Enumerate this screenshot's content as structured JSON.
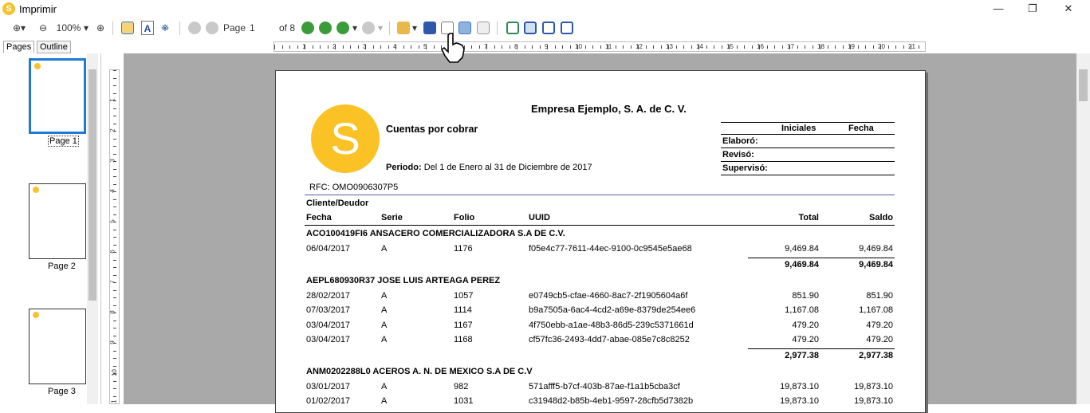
{
  "window": {
    "title": "Imprimir",
    "app_icon_letter": "S"
  },
  "controls": {
    "minimize": "—",
    "maximize": "❐",
    "close": "✕"
  },
  "toolbar": {
    "zoom_level": "100%",
    "page_label": "Page",
    "page_value": "1",
    "page_of": "of 8"
  },
  "tabs": [
    {
      "label": "Pages"
    },
    {
      "label": "Outline"
    }
  ],
  "thumbnails": [
    {
      "label": "Page 1"
    },
    {
      "label": "Page 2"
    },
    {
      "label": "Page 3"
    }
  ],
  "ruler": {
    "marks": [
      "1",
      "2",
      "3",
      "4",
      "5",
      "6",
      "7",
      "8",
      "9",
      "10",
      "11",
      "12",
      "13",
      "14",
      "15",
      "16",
      "17",
      "18",
      "19",
      "20",
      "21"
    ]
  },
  "vruler": {
    "marks": [
      "1",
      "2",
      "3",
      "4",
      "5",
      "6",
      "7",
      "8",
      "9",
      "10",
      "11"
    ]
  },
  "report": {
    "logo_letter": "S",
    "company": "Empresa Ejemplo, S. A. de C. V.",
    "title": "Cuentas por cobrar",
    "period_label": "Periodo:",
    "period_value": "Del 1 de Enero al 31 de Diciembre de 2017",
    "rfc": "RFC: OMO0906307P5",
    "sig_headers": [
      "Iniciales",
      "Fecha"
    ],
    "sig_rows": [
      "Elaboró:",
      "Revisó:",
      "Supervisó:"
    ],
    "group_header": "Cliente/Deudor",
    "columns": [
      "Fecha",
      "Serie",
      "Folio",
      "UUID",
      "Total",
      "Saldo"
    ],
    "groups": [
      {
        "name": "ACO100419FI6 ANSACERO COMERCIALIZADORA S.A DE C.V.",
        "rows": [
          {
            "fecha": "06/04/2017",
            "serie": "A",
            "folio": "1176",
            "uuid": "f05e4c77-7611-44ec-9100-0c9545e5ae68",
            "total": "9,469.84",
            "saldo": "9,469.84"
          }
        ],
        "total": "9,469.84",
        "saldo": "9,469.84"
      },
      {
        "name": "AEPL680930R37 JOSE LUIS ARTEAGA PEREZ",
        "rows": [
          {
            "fecha": "28/02/2017",
            "serie": "A",
            "folio": "1057",
            "uuid": "e0749cb5-cfae-4660-8ac7-2f1905604a6f",
            "total": "851.90",
            "saldo": "851.90"
          },
          {
            "fecha": "07/03/2017",
            "serie": "A",
            "folio": "1114",
            "uuid": "b9a7505a-6ac4-4cd2-a69e-8379de254ee6",
            "total": "1,167.08",
            "saldo": "1,167.08"
          },
          {
            "fecha": "03/04/2017",
            "serie": "A",
            "folio": "1167",
            "uuid": "4f750ebb-a1ae-48b3-86d5-239c5371661d",
            "total": "479.20",
            "saldo": "479.20"
          },
          {
            "fecha": "03/04/2017",
            "serie": "A",
            "folio": "1168",
            "uuid": "cf57fc36-2493-4dd7-abae-085e7c8c8252",
            "total": "479.20",
            "saldo": "479.20"
          }
        ],
        "total": "2,977.38",
        "saldo": "2,977.38"
      },
      {
        "name": "ANM0202288L0 ACEROS A. N. DE MEXICO  S.A DE C.V",
        "rows": [
          {
            "fecha": "03/01/2017",
            "serie": "A",
            "folio": "982",
            "uuid": "571afff5-b7cf-403b-87ae-f1a1b5cba3cf",
            "total": "19,873.10",
            "saldo": "19,873.10"
          },
          {
            "fecha": "01/02/2017",
            "serie": "A",
            "folio": "1031",
            "uuid": "c31948d2-b85b-4eb1-9597-28cfb5d7382b",
            "total": "19,873.10",
            "saldo": "19,873.10"
          }
        ]
      }
    ]
  }
}
